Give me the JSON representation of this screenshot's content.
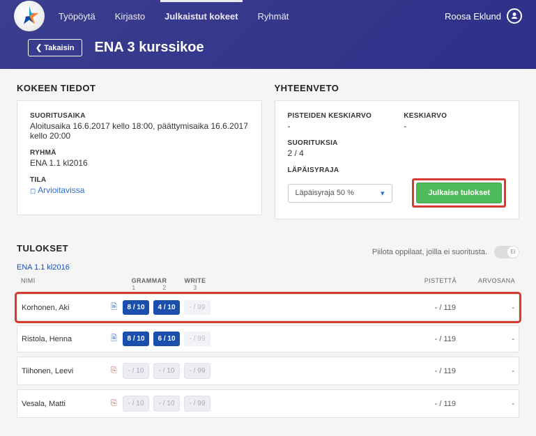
{
  "nav": {
    "tabs": [
      "Työpöytä",
      "Kirjasto",
      "Julkaistut kokeet",
      "Ryhmät"
    ],
    "active": 2,
    "user": "Roosa Eklund"
  },
  "back": "Takaisin",
  "title": "ENA 3 kurssikoe",
  "details": {
    "heading": "KOKEEN TIEDOT",
    "time_label": "SUORITUSAIKA",
    "time_value": "Aloitusaika 16.6.2017 kello 18:00, päättymisaika 16.6.2017 kello 20:00",
    "group_label": "RYHMÄ",
    "group_value": "ENA 1.1 kl2016",
    "status_label": "TILA",
    "status_value": "Arvioitavissa"
  },
  "summary": {
    "heading": "YHTEENVETO",
    "avg_pts_label": "PISTEIDEN KESKIARVO",
    "avg_pts_value": "-",
    "avg_label": "KESKIARVO",
    "avg_value": "-",
    "count_label": "SUORITUKSIA",
    "count_value": "2 / 4",
    "pass_label": "LÄPÄISYRAJA",
    "pass_value": "Läpäisyraja 50 %",
    "publish": "Julkaise tulokset"
  },
  "results": {
    "heading": "TULOKSET",
    "hide_label": "Piilota oppilaat, joilla ei suoritusta.",
    "toggle_text": "Ei",
    "group": "ENA 1.1 kl2016",
    "col_name": "NIMI",
    "col_groups": [
      "GRAMMAR",
      "WRITE"
    ],
    "col_tasks": [
      "1",
      "2",
      "3"
    ],
    "col_points": "PISTETTÄ",
    "col_grade": "ARVOSANA",
    "rows": [
      {
        "name": "Korhonen, Aki",
        "flag": "blue",
        "cells": [
          "8 / 10",
          "4 / 10",
          "- / 99"
        ],
        "styles": [
          "blue",
          "blue",
          "graylight"
        ],
        "points": "- / 119",
        "grade": "-",
        "hl": true
      },
      {
        "name": "Ristola, Henna",
        "flag": "blue",
        "cells": [
          "8 / 10",
          "6 / 10",
          "- / 99"
        ],
        "styles": [
          "blue",
          "blue",
          "graylight"
        ],
        "points": "- / 119",
        "grade": "-"
      },
      {
        "name": "Tiihonen, Leevi",
        "flag": "red",
        "cells": [
          "- / 10",
          "- / 10",
          "- / 99"
        ],
        "styles": [
          "gray",
          "gray",
          "gray"
        ],
        "points": "- / 119",
        "grade": "-"
      },
      {
        "name": "Vesala, Matti",
        "flag": "red",
        "cells": [
          "- / 10",
          "- / 10",
          "- / 99"
        ],
        "styles": [
          "gray",
          "gray",
          "gray"
        ],
        "points": "- / 119",
        "grade": "-"
      }
    ]
  }
}
